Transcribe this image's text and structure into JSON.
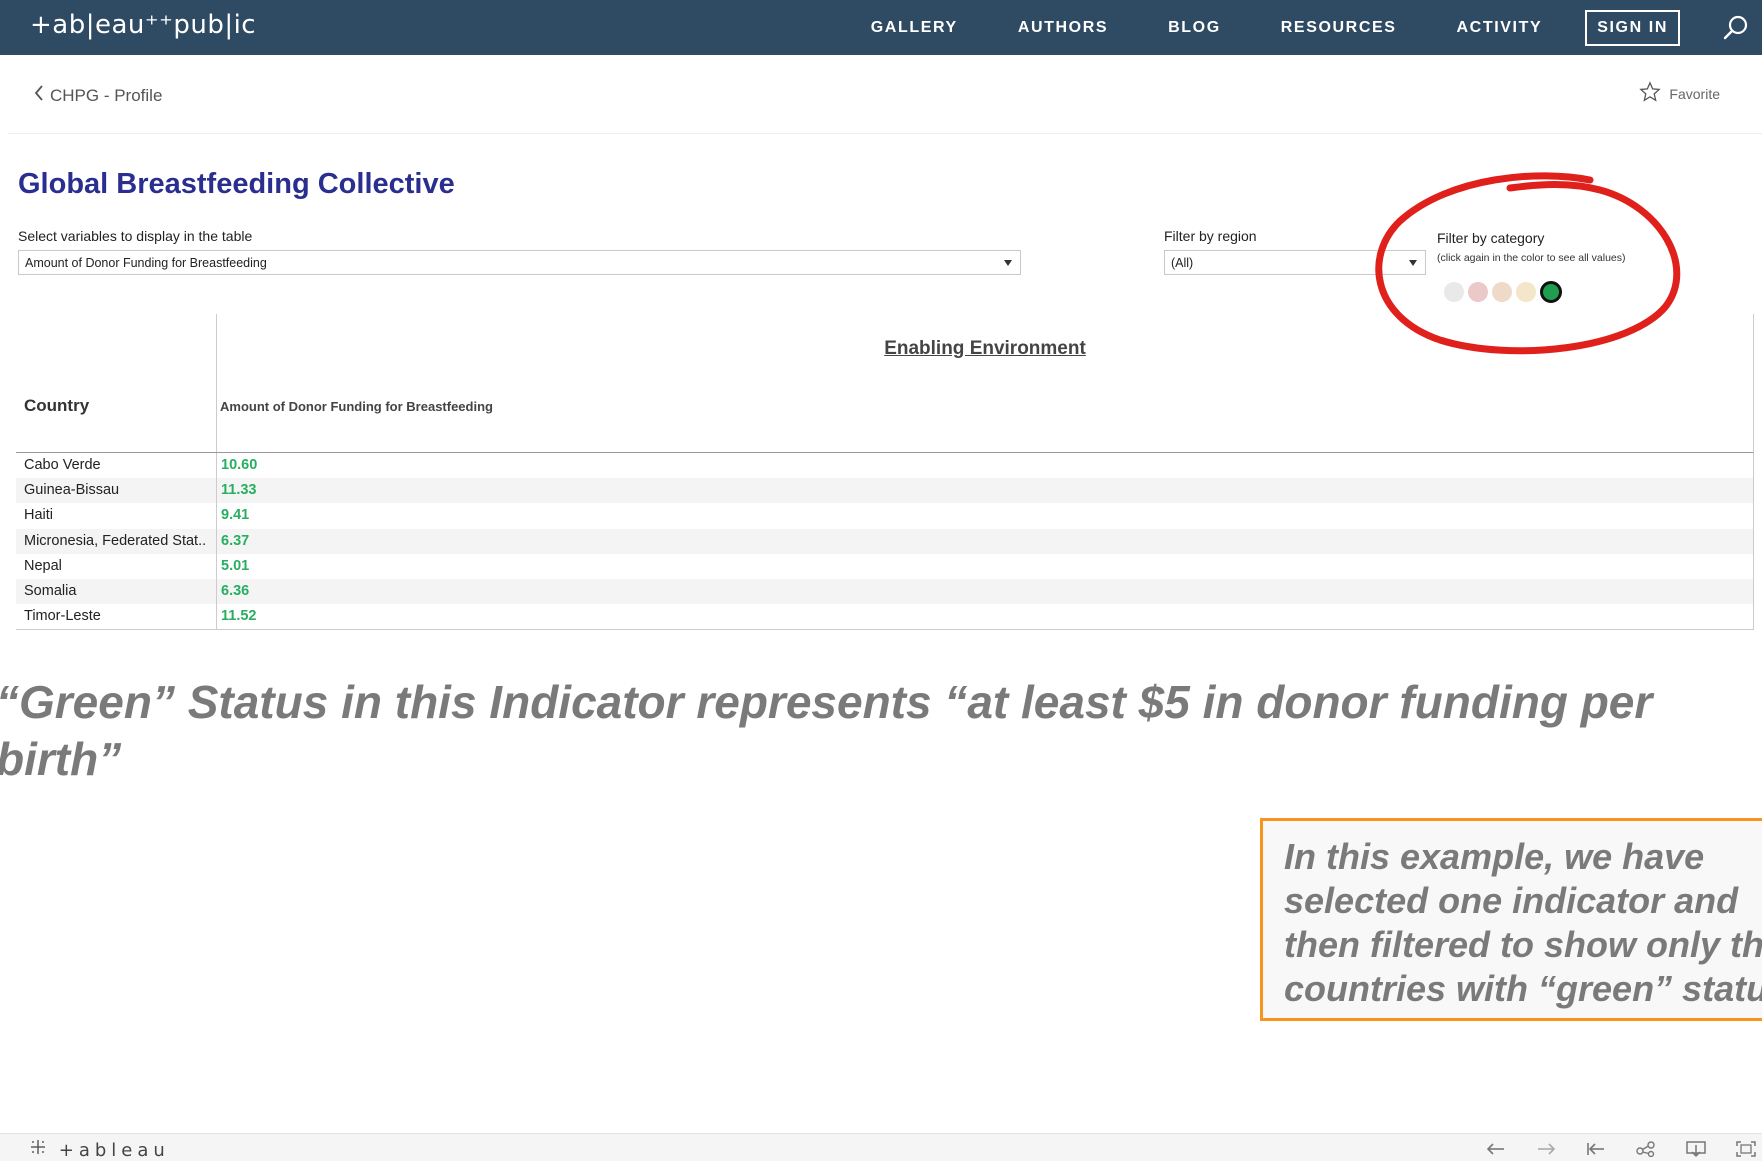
{
  "nav": {
    "logo": "+ab|eau⁺⁺pub|ic",
    "items": [
      "GALLERY",
      "AUTHORS",
      "BLOG",
      "RESOURCES",
      "ACTIVITY"
    ],
    "signin": "SIGN IN"
  },
  "subheader": {
    "back_label": "CHPG - Profile",
    "favorite_label": "Favorite"
  },
  "viz": {
    "title": "Global Breastfeeding Collective",
    "variables_label": "Select variables to display in the table",
    "variables_value": "Amount of Donor Funding for Breastfeeding",
    "region_label": "Filter by region",
    "region_value": "(All)",
    "category_label": "Filter by category",
    "category_note": "(click again in the color to see all values)",
    "category_colors": [
      "#e9e9e9",
      "#ebc9c9",
      "#efd9c9",
      "#f3e6c9",
      "#1e9e4e"
    ],
    "annotation_color": "#e0201b"
  },
  "table": {
    "section_title": "Enabling Environment",
    "country_header": "Country",
    "measure_header": "Amount of Donor Funding for Breastfeeding",
    "rows": [
      {
        "country": "Cabo Verde",
        "value": "10.60"
      },
      {
        "country": "Guinea-Bissau",
        "value": "11.33"
      },
      {
        "country": "Haiti",
        "value": "9.41"
      },
      {
        "country": "Micronesia, Federated Stat..",
        "value": "6.37"
      },
      {
        "country": "Nepal",
        "value": "5.01"
      },
      {
        "country": "Somalia",
        "value": "6.36"
      },
      {
        "country": "Timor-Leste",
        "value": "11.52"
      }
    ]
  },
  "notes": {
    "green_status": "“Green” Status in this Indicator represents “at least $5 in donor funding per birth”",
    "example": "In this example, we have\nselected one indicator and\nthen filtered to show only th\ncountries with “green” statu"
  },
  "footer": {
    "logo": "+ableau"
  }
}
